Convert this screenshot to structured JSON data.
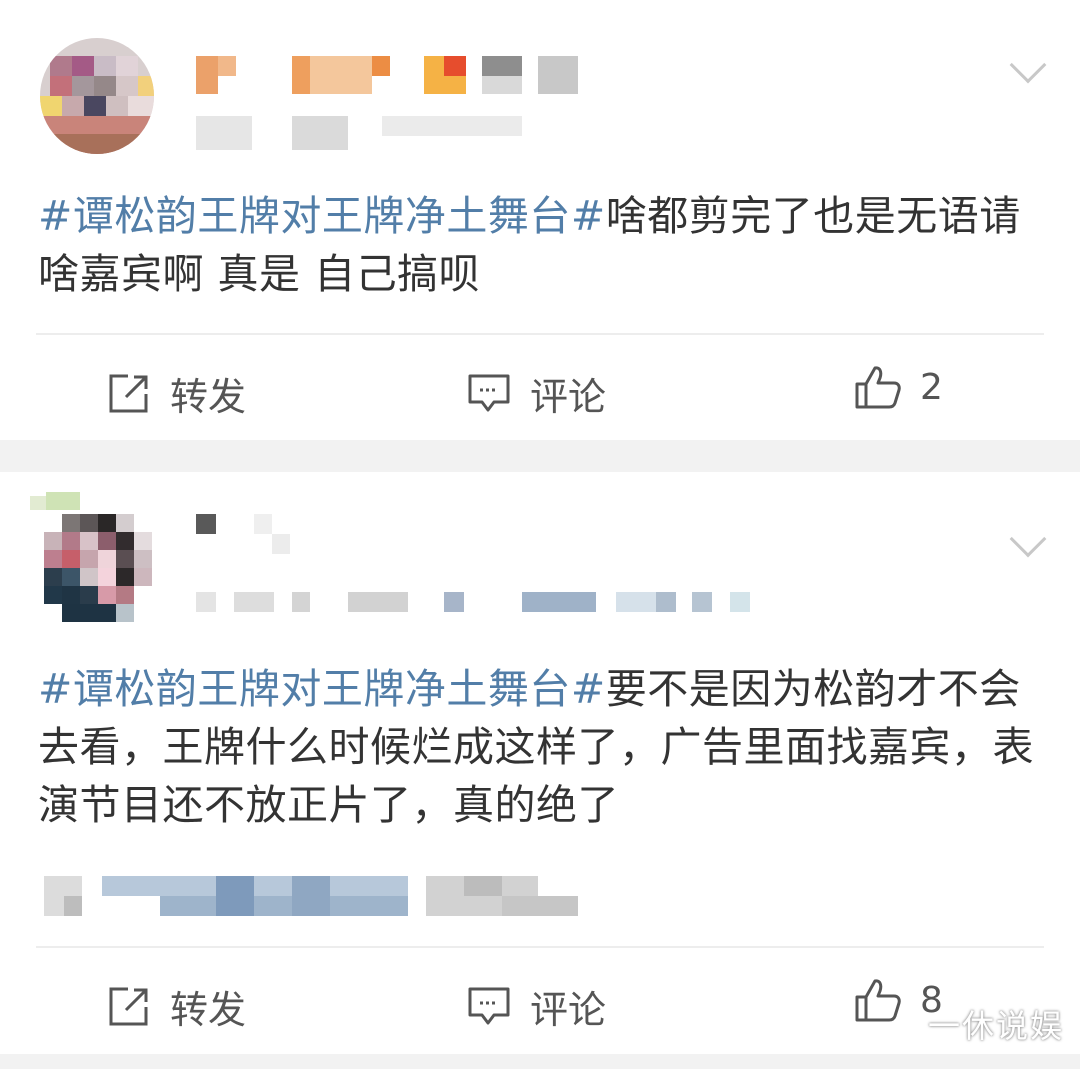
{
  "posts": [
    {
      "text_hashtag": "#谭松韵王牌对王牌净土舞台#",
      "text_body": "啥都剪完了也是无语请啥嘉宾啊 真是 自己搞呗",
      "actions": {
        "repost_label": "转发",
        "comment_label": "评论",
        "like_count": "2"
      }
    },
    {
      "text_hashtag": "#谭松韵王牌对王牌净土舞台#",
      "text_body": "要不是因为松韵才不会去看，王牌什么时候烂成这样了，广告里面找嘉宾，表演节目还不放正片了，真的绝了",
      "actions": {
        "repost_label": "转发",
        "comment_label": "评论",
        "like_count": "8"
      }
    }
  ],
  "watermark": "一休说娱",
  "icons": {
    "repost": "edit-share-icon",
    "comment": "comment-bubble-icon",
    "like": "thumbs-up-icon",
    "menu": "chevron-down-icon"
  },
  "colors": {
    "hashtag": "#527ea8",
    "text": "#333333",
    "action_text": "#555555",
    "separator": "#f2f2f2"
  }
}
